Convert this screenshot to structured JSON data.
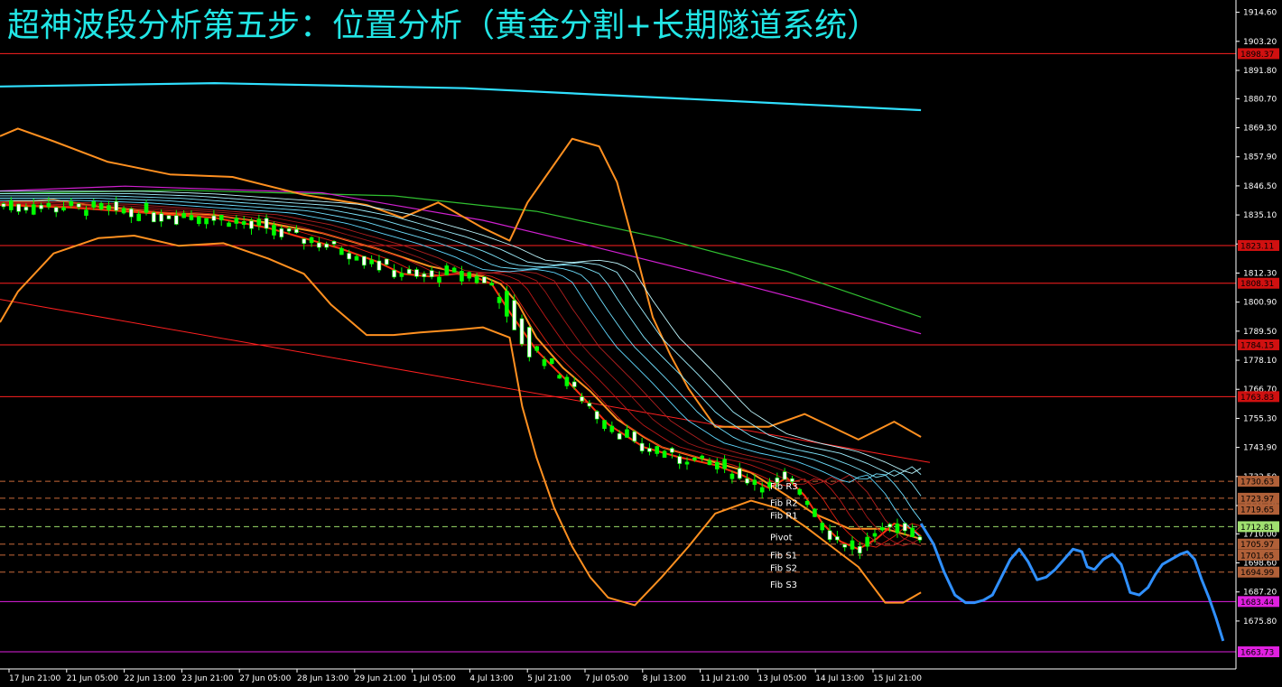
{
  "title": "超神波段分析第五步：位置分析（黄金分割+长期隧道系统）",
  "chart_data": {
    "type": "candlestick",
    "y_axis_side": "right",
    "ylim": [
      1657,
      1918
    ],
    "y_ticks": [
      "1914.60",
      "1903.20",
      "1891.80",
      "1880.70",
      "1869.30",
      "1857.90",
      "1846.50",
      "1835.10",
      "1823.70",
      "1812.30",
      "1800.90",
      "1789.50",
      "1778.10",
      "1766.70",
      "1755.30",
      "1743.90",
      "1732.50",
      "1721.10",
      "1710.00",
      "1698.60",
      "1687.20",
      "1675.80"
    ],
    "x_ticks": [
      "17 Jun 21:00",
      "21 Jun 05:00",
      "22 Jun 13:00",
      "23 Jun 21:00",
      "27 Jun 05:00",
      "28 Jun 13:00",
      "29 Jun 21:00",
      "1 Jul 05:00",
      "4 Jul 13:00",
      "5 Jul 21:00",
      "7 Jul 05:00",
      "8 Jul 13:00",
      "11 Jul 21:00",
      "13 Jul 05:00",
      "14 Jul 13:00",
      "15 Jul 21:00"
    ],
    "horizontal_levels": [
      {
        "label": "1898.37",
        "value": 1898.37,
        "color": "#ff2020",
        "style": "solid",
        "badge": "#d01010"
      },
      {
        "label": "1823.11",
        "value": 1823.11,
        "color": "#ff2020",
        "style": "solid",
        "badge": "#d01010"
      },
      {
        "label": "1808.31",
        "value": 1808.31,
        "color": "#ff2020",
        "style": "solid",
        "badge": "#d01010"
      },
      {
        "label": "1784.15",
        "value": 1784.15,
        "color": "#ff2020",
        "style": "solid",
        "badge": "#d01010"
      },
      {
        "label": "1763.83",
        "value": 1763.83,
        "color": "#ff2020",
        "style": "solid",
        "badge": "#d01010"
      },
      {
        "label": "1730.63",
        "value": 1730.63,
        "color": "#c86a3a",
        "style": "dash",
        "badge": "#b06038"
      },
      {
        "label": "1723.97",
        "value": 1723.97,
        "color": "#c86a3a",
        "style": "dash",
        "badge": "#b06038"
      },
      {
        "label": "1719.65",
        "value": 1719.65,
        "color": "#c86a3a",
        "style": "dash",
        "badge": "#b06038"
      },
      {
        "label": "1712.81",
        "value": 1712.81,
        "color": "#9adb6a",
        "style": "dash",
        "badge": "#a0e070"
      },
      {
        "label": "1705.97",
        "value": 1705.97,
        "color": "#c86a3a",
        "style": "dash",
        "badge": "#b06038"
      },
      {
        "label": "1701.65",
        "value": 1701.65,
        "color": "#c86a3a",
        "style": "dash",
        "badge": "#b06038"
      },
      {
        "label": "1694.99",
        "value": 1694.99,
        "color": "#c86a3a",
        "style": "dash",
        "badge": "#b06038"
      },
      {
        "label": "1683.44",
        "value": 1683.44,
        "color": "#e020e0",
        "style": "solid",
        "badge": "#e020e0"
      },
      {
        "label": "1663.73",
        "value": 1663.73,
        "color": "#e020e0",
        "style": "solid",
        "badge": "#e020e0"
      }
    ],
    "fib_labels": [
      {
        "text": "Fib R3",
        "value": 1728.5
      },
      {
        "text": "Fib R2",
        "value": 1722.0
      },
      {
        "text": "Fib R1",
        "value": 1717.0
      },
      {
        "text": "Pivot",
        "value": 1708.5
      },
      {
        "text": "Fib S1",
        "value": 1701.5
      },
      {
        "text": "Fib S2",
        "value": 1696.5
      },
      {
        "text": "Fib S3",
        "value": 1690.0
      }
    ],
    "colors": {
      "up_candle": "#ffffff",
      "down_candle": "#00ff00",
      "bollinger": "#ff9020",
      "long_ma": "#30e0ff",
      "green_ma": "#30c030",
      "magenta_ma": "#d020d0",
      "trend_line": "#ff2020",
      "projection": "#3090ff",
      "title": "#22e6e6"
    },
    "x_count": 520,
    "candles_end_x": 515,
    "series": {
      "long_ma": {
        "x": [
          0,
          120,
          260,
          515
        ],
        "y": [
          1885.5,
          1886.8,
          1884.8,
          1876.2
        ]
      },
      "green_ma": {
        "x": [
          0,
          100,
          220,
          300,
          370,
          440,
          515
        ],
        "y": [
          1843.5,
          1844.8,
          1842.6,
          1836.5,
          1826,
          1813,
          1795
        ]
      },
      "magenta_ma": {
        "x": [
          0,
          70,
          180,
          270,
          330,
          390,
          450,
          515
        ],
        "y": [
          1844.5,
          1846.4,
          1843.8,
          1833,
          1823,
          1812.5,
          1801.5,
          1788.5
        ]
      },
      "trend_line": {
        "x": [
          0,
          520
        ],
        "y": [
          1802,
          1738
        ]
      },
      "boll_upper": {
        "x": [
          0,
          10,
          30,
          60,
          95,
          130,
          170,
          205,
          225,
          245,
          270,
          285,
          295,
          305,
          320,
          335,
          345,
          355,
          365,
          375,
          385,
          400,
          430,
          450,
          480,
          500,
          515
        ],
        "y": [
          1866,
          1869,
          1864,
          1856,
          1851,
          1850,
          1843,
          1839,
          1834,
          1840,
          1830,
          1825,
          1840,
          1850,
          1865,
          1862,
          1848,
          1822,
          1795,
          1780,
          1767,
          1752,
          1752,
          1757,
          1747,
          1754,
          1748
        ]
      },
      "boll_middle": {
        "x": [
          0,
          30,
          60,
          90,
          120,
          150,
          180,
          210,
          240,
          260,
          270,
          280,
          290,
          300,
          315,
          330,
          345,
          360,
          370,
          380,
          400,
          420,
          440,
          455,
          475,
          495,
          515
        ],
        "y": [
          1840,
          1841,
          1838,
          1836,
          1835,
          1832,
          1828,
          1822,
          1815,
          1812,
          1811,
          1808,
          1800,
          1787,
          1775,
          1766,
          1755,
          1748,
          1744,
          1742,
          1738,
          1734,
          1725,
          1718,
          1712,
          1712,
          1708
        ]
      },
      "boll_lower": {
        "x": [
          0,
          10,
          30,
          55,
          75,
          100,
          125,
          150,
          170,
          185,
          205,
          220,
          235,
          255,
          270,
          285,
          292,
          300,
          310,
          320,
          330,
          340,
          355,
          370,
          385,
          400,
          420,
          435,
          450,
          465,
          480,
          495,
          505,
          515
        ],
        "y": [
          1793,
          1805,
          1820,
          1826,
          1827,
          1823,
          1824,
          1818,
          1812,
          1800,
          1788,
          1788,
          1789,
          1790,
          1791,
          1787,
          1760,
          1740,
          1720,
          1705,
          1693,
          1685,
          1682,
          1693,
          1705,
          1718,
          1723,
          1720,
          1713,
          1705,
          1697,
          1683,
          1683,
          1687
        ]
      },
      "ema_fast": {
        "x": [
          0,
          40,
          80,
          120,
          150,
          170,
          190,
          210,
          225,
          240,
          255,
          265,
          275,
          285,
          300,
          320,
          340,
          360,
          380,
          400,
          415,
          430,
          440,
          450,
          460,
          470,
          480,
          490,
          500,
          510,
          515
        ],
        "y": [
          1839,
          1838,
          1836,
          1834,
          1830,
          1826,
          1822,
          1817,
          1812,
          1811,
          1812,
          1811,
          1808,
          1797,
          1782,
          1768,
          1753,
          1744,
          1740,
          1737,
          1733,
          1728,
          1732,
          1725,
          1714,
          1707,
          1704,
          1708,
          1714,
          1712,
          1709
        ]
      }
    },
    "projection": {
      "x": [
        515,
        522,
        528,
        534,
        540,
        545,
        550,
        555,
        560,
        565,
        570,
        575,
        580,
        585,
        590,
        595,
        600,
        605,
        608,
        612,
        617,
        622,
        627,
        632,
        637,
        642,
        646,
        650,
        655,
        660,
        664,
        668,
        672,
        676,
        680,
        684
      ],
      "y": [
        1714,
        1706,
        1695,
        1686,
        1683,
        1683,
        1684,
        1686,
        1693,
        1700,
        1704,
        1699,
        1692,
        1693,
        1696,
        1700,
        1704,
        1703,
        1697,
        1696,
        1700,
        1702,
        1698,
        1687,
        1686,
        1689,
        1694,
        1698,
        1700,
        1702,
        1703,
        1700,
        1692,
        1685,
        1677,
        1668
      ]
    }
  }
}
